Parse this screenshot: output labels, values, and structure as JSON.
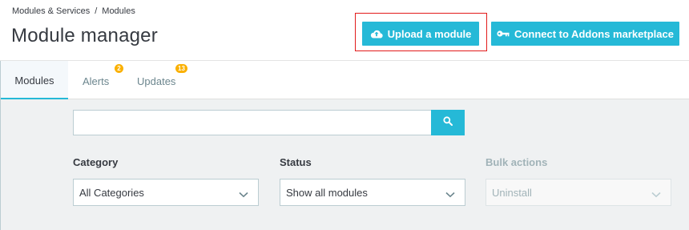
{
  "breadcrumb": {
    "parent": "Modules & Services",
    "separator": "/",
    "current": "Modules"
  },
  "page_title": "Module manager",
  "toolbar": {
    "upload_label": "Upload a module",
    "upload_icon": "cloud-upload-icon",
    "connect_label": "Connect to Addons marketplace",
    "connect_icon": "key-icon"
  },
  "tabs": [
    {
      "label": "Modules",
      "active": true
    },
    {
      "label": "Alerts",
      "badge": "2"
    },
    {
      "label": "Updates",
      "badge": "13"
    }
  ],
  "search": {
    "value": "",
    "placeholder": "",
    "button_icon": "search-icon"
  },
  "filters": {
    "category": {
      "label": "Category",
      "selected": "All Categories"
    },
    "status": {
      "label": "Status",
      "selected": "Show all modules"
    },
    "bulk": {
      "label": "Bulk actions",
      "selected": "Uninstall",
      "disabled": true
    }
  },
  "colors": {
    "primary": "#25b9d7",
    "badge": "#fab000",
    "highlight": "#e21b1b",
    "content_bg": "#eff1f2"
  }
}
